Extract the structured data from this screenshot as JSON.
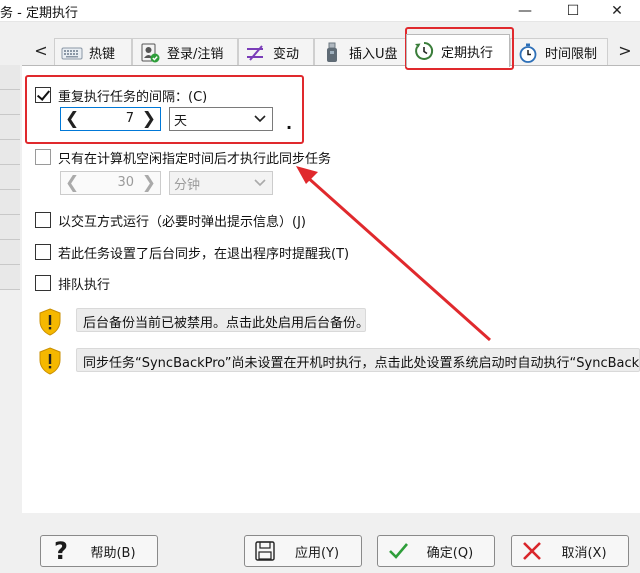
{
  "window": {
    "title": "务 - 定期执行",
    "minimize_glyph": "—",
    "maximize_glyph": "☐",
    "close_glyph": "✕"
  },
  "tabs": {
    "prev_glyph": "<",
    "next_glyph": ">",
    "items": [
      {
        "label": "热键",
        "icon": "keyboard-icon"
      },
      {
        "label": "登录/注销",
        "icon": "user-login-icon"
      },
      {
        "label": "变动",
        "icon": "change-icon"
      },
      {
        "label": "插入U盘",
        "icon": "usb-icon"
      },
      {
        "label": "定期执行",
        "icon": "refresh-clock-icon",
        "active": true
      },
      {
        "label": "时间限制",
        "icon": "stopwatch-icon"
      }
    ]
  },
  "repeat": {
    "label": "重复执行任务的间隔：(C)",
    "checked": true,
    "interval_value": "7",
    "unit": "天",
    "trailing_dot": "."
  },
  "idle": {
    "label": "只有在计算机空闲指定时间后才执行此同步任务",
    "checked": false,
    "value": "30",
    "unit": "分钟"
  },
  "options": [
    {
      "label": "以交互方式运行（必要时弹出提示信息）(J)",
      "checked": false
    },
    {
      "label": "若此任务设置了后台同步，在退出程序时提醒我(T)",
      "checked": false
    },
    {
      "label": "排队执行",
      "checked": false
    }
  ],
  "notices": [
    {
      "text": "后台备份当前已被禁用。点击此处启用后台备份。",
      "icon": "warning-shield-icon"
    },
    {
      "text": "同步任务“SyncBackPro”尚未设置在开机时执行，点击此处设置系统启动时自动执行“SyncBackPro”同步",
      "icon": "warning-shield-icon"
    }
  ],
  "buttons": {
    "help": "帮助(B)",
    "apply": "应用(Y)",
    "ok": "确定(Q)",
    "cancel": "取消(X)"
  },
  "colors": {
    "annotation_red": "#e0292d",
    "focus_blue": "#0078d7",
    "warning_yellow": "#f5b800",
    "ok_green": "#2e9e3a",
    "cancel_red": "#d9262b"
  }
}
